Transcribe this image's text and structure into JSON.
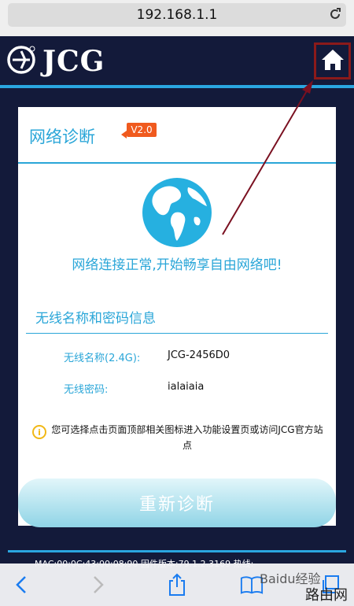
{
  "browser": {
    "url": "192.168.1.1",
    "reload_icon": "reload-icon",
    "toolbar_icons": [
      "back-icon",
      "forward-icon",
      "share-icon",
      "bookmarks-icon",
      "tabs-icon"
    ]
  },
  "header": {
    "logo_text": "JCG",
    "logo_icon": "jcg-emblem-icon",
    "home_icon": "home-icon",
    "colors": {
      "background": "#131a3a",
      "accent_line": "#2aa6e0",
      "home_highlight": "#8b1a1a"
    }
  },
  "card": {
    "title": "网络诊断",
    "version": "V2.0",
    "globe_icon": "globe-icon",
    "status_message": "网络连接正常,开始畅享自由网络吧!",
    "wifi_section_title": "无线名称和密码信息",
    "wifi": {
      "ssid_label": "无线名称(2.4G):",
      "ssid_value": "JCG-2456D0",
      "password_label": "无线密码:",
      "password_value": "ialaiaia"
    },
    "notice_icon": "info-icon",
    "notice_text": "您可选择点击页面顶部相关图标进入功能设置页或访问JCG官方站点",
    "rediagnose_label": "重新诊断",
    "colors": {
      "accent": "#2aa6d8",
      "badge": "#f05a1e"
    }
  },
  "footer": {
    "text": "MAC:00:0C:43:00:08:90  固件版本:79.1.2.3169  热线:"
  },
  "watermark": {
    "baidu_text": "Baidu经验",
    "site_text": "路由网"
  }
}
